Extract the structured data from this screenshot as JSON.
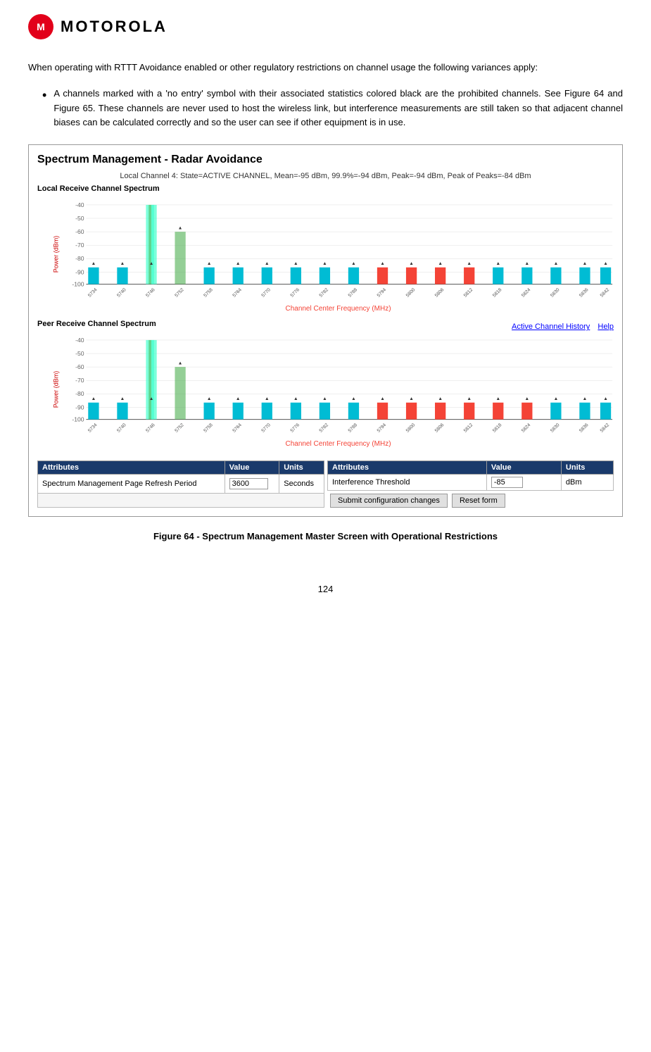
{
  "header": {
    "logo_symbol": "M",
    "brand_name": "MOTOROLA"
  },
  "body_paragraph": "When  operating  with  RTTT  Avoidance  enabled  or  other  regulatory  restrictions  on  channel usage the following variances apply:",
  "bullet_text": "A channels marked with a 'no entry' symbol with their associated statistics colored black are  the  prohibited  channels.  See  Figure  64  and  Figure  65.  These  channels  are  never used  to  host  the  wireless  link,  but  interference  measurements  are  still  taken  so  that adjacent  channel  biases  can  be  calculated  correctly  and  so  the  user  can  see  if  other equipment is in use.",
  "figure": {
    "title": "Spectrum Management - Radar Avoidance",
    "channel_info": "Local Channel 4: State=ACTIVE CHANNEL, Mean=-95 dBm, 99.9%=-94 dBm, Peak=-94 dBm, Peak of Peaks=-84 dBm",
    "local_chart_label": "Local Receive Channel Spectrum",
    "peer_chart_label": "Peer Receive Channel Spectrum",
    "x_axis_label": "Channel  Center Frequency (MHz)",
    "y_axis_label": "Power (dBm)",
    "active_channel_history": "Active Channel History",
    "help_link": "Help",
    "frequencies": [
      "5734",
      "5740",
      "5746",
      "5752",
      "5758",
      "5764",
      "5770",
      "5776",
      "5782",
      "5788",
      "5794",
      "5800",
      "5806",
      "5812",
      "5818",
      "5824",
      "5830",
      "5836",
      "5842"
    ],
    "y_labels": [
      "-40",
      "-50",
      "-60",
      "-70",
      "-80",
      "-90",
      "-100"
    ],
    "table": {
      "headers_left": [
        "Attributes",
        "Value",
        "Units"
      ],
      "headers_right": [
        "Attributes",
        "Value",
        "Units"
      ],
      "row1_left": {
        "attribute": "Spectrum Management Page Refresh Period",
        "value": "3600",
        "units": "Seconds"
      },
      "row1_right": {
        "attribute": "Interference Threshold",
        "value": "-85",
        "units": "dBm"
      }
    },
    "submit_button": "Submit configuration changes",
    "reset_button": "Reset form"
  },
  "figure_caption": "Figure 64 - Spectrum Management Master Screen with Operational Restrictions",
  "page_number": "124"
}
